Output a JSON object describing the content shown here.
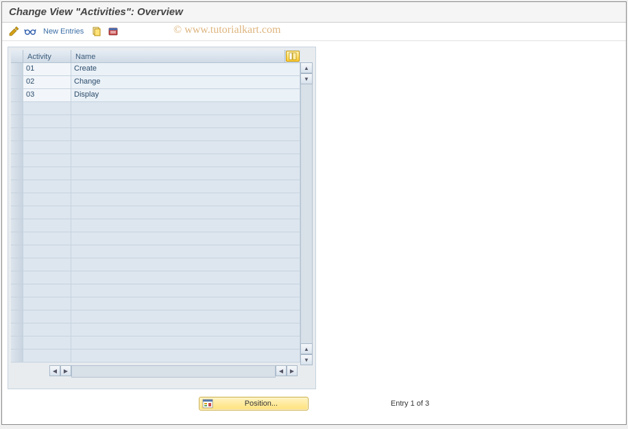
{
  "title": "Change View \"Activities\": Overview",
  "watermark": "© www.tutorialkart.com",
  "toolbar": {
    "new_entries_label": "New Entries"
  },
  "table": {
    "columns": {
      "activity": "Activity",
      "name": "Name"
    },
    "rows": [
      {
        "activity": "01",
        "name": "Create"
      },
      {
        "activity": "02",
        "name": "Change"
      },
      {
        "activity": "03",
        "name": "Display"
      }
    ],
    "empty_row_count": 20
  },
  "footer": {
    "position_label": "Position...",
    "entry_status": "Entry 1 of 3"
  },
  "icons": {
    "pencil_color": "#d4a017",
    "glasses_color": "#2a5aaa",
    "copy_color": "#d4a017",
    "delete_bg": "#c94a4a"
  }
}
